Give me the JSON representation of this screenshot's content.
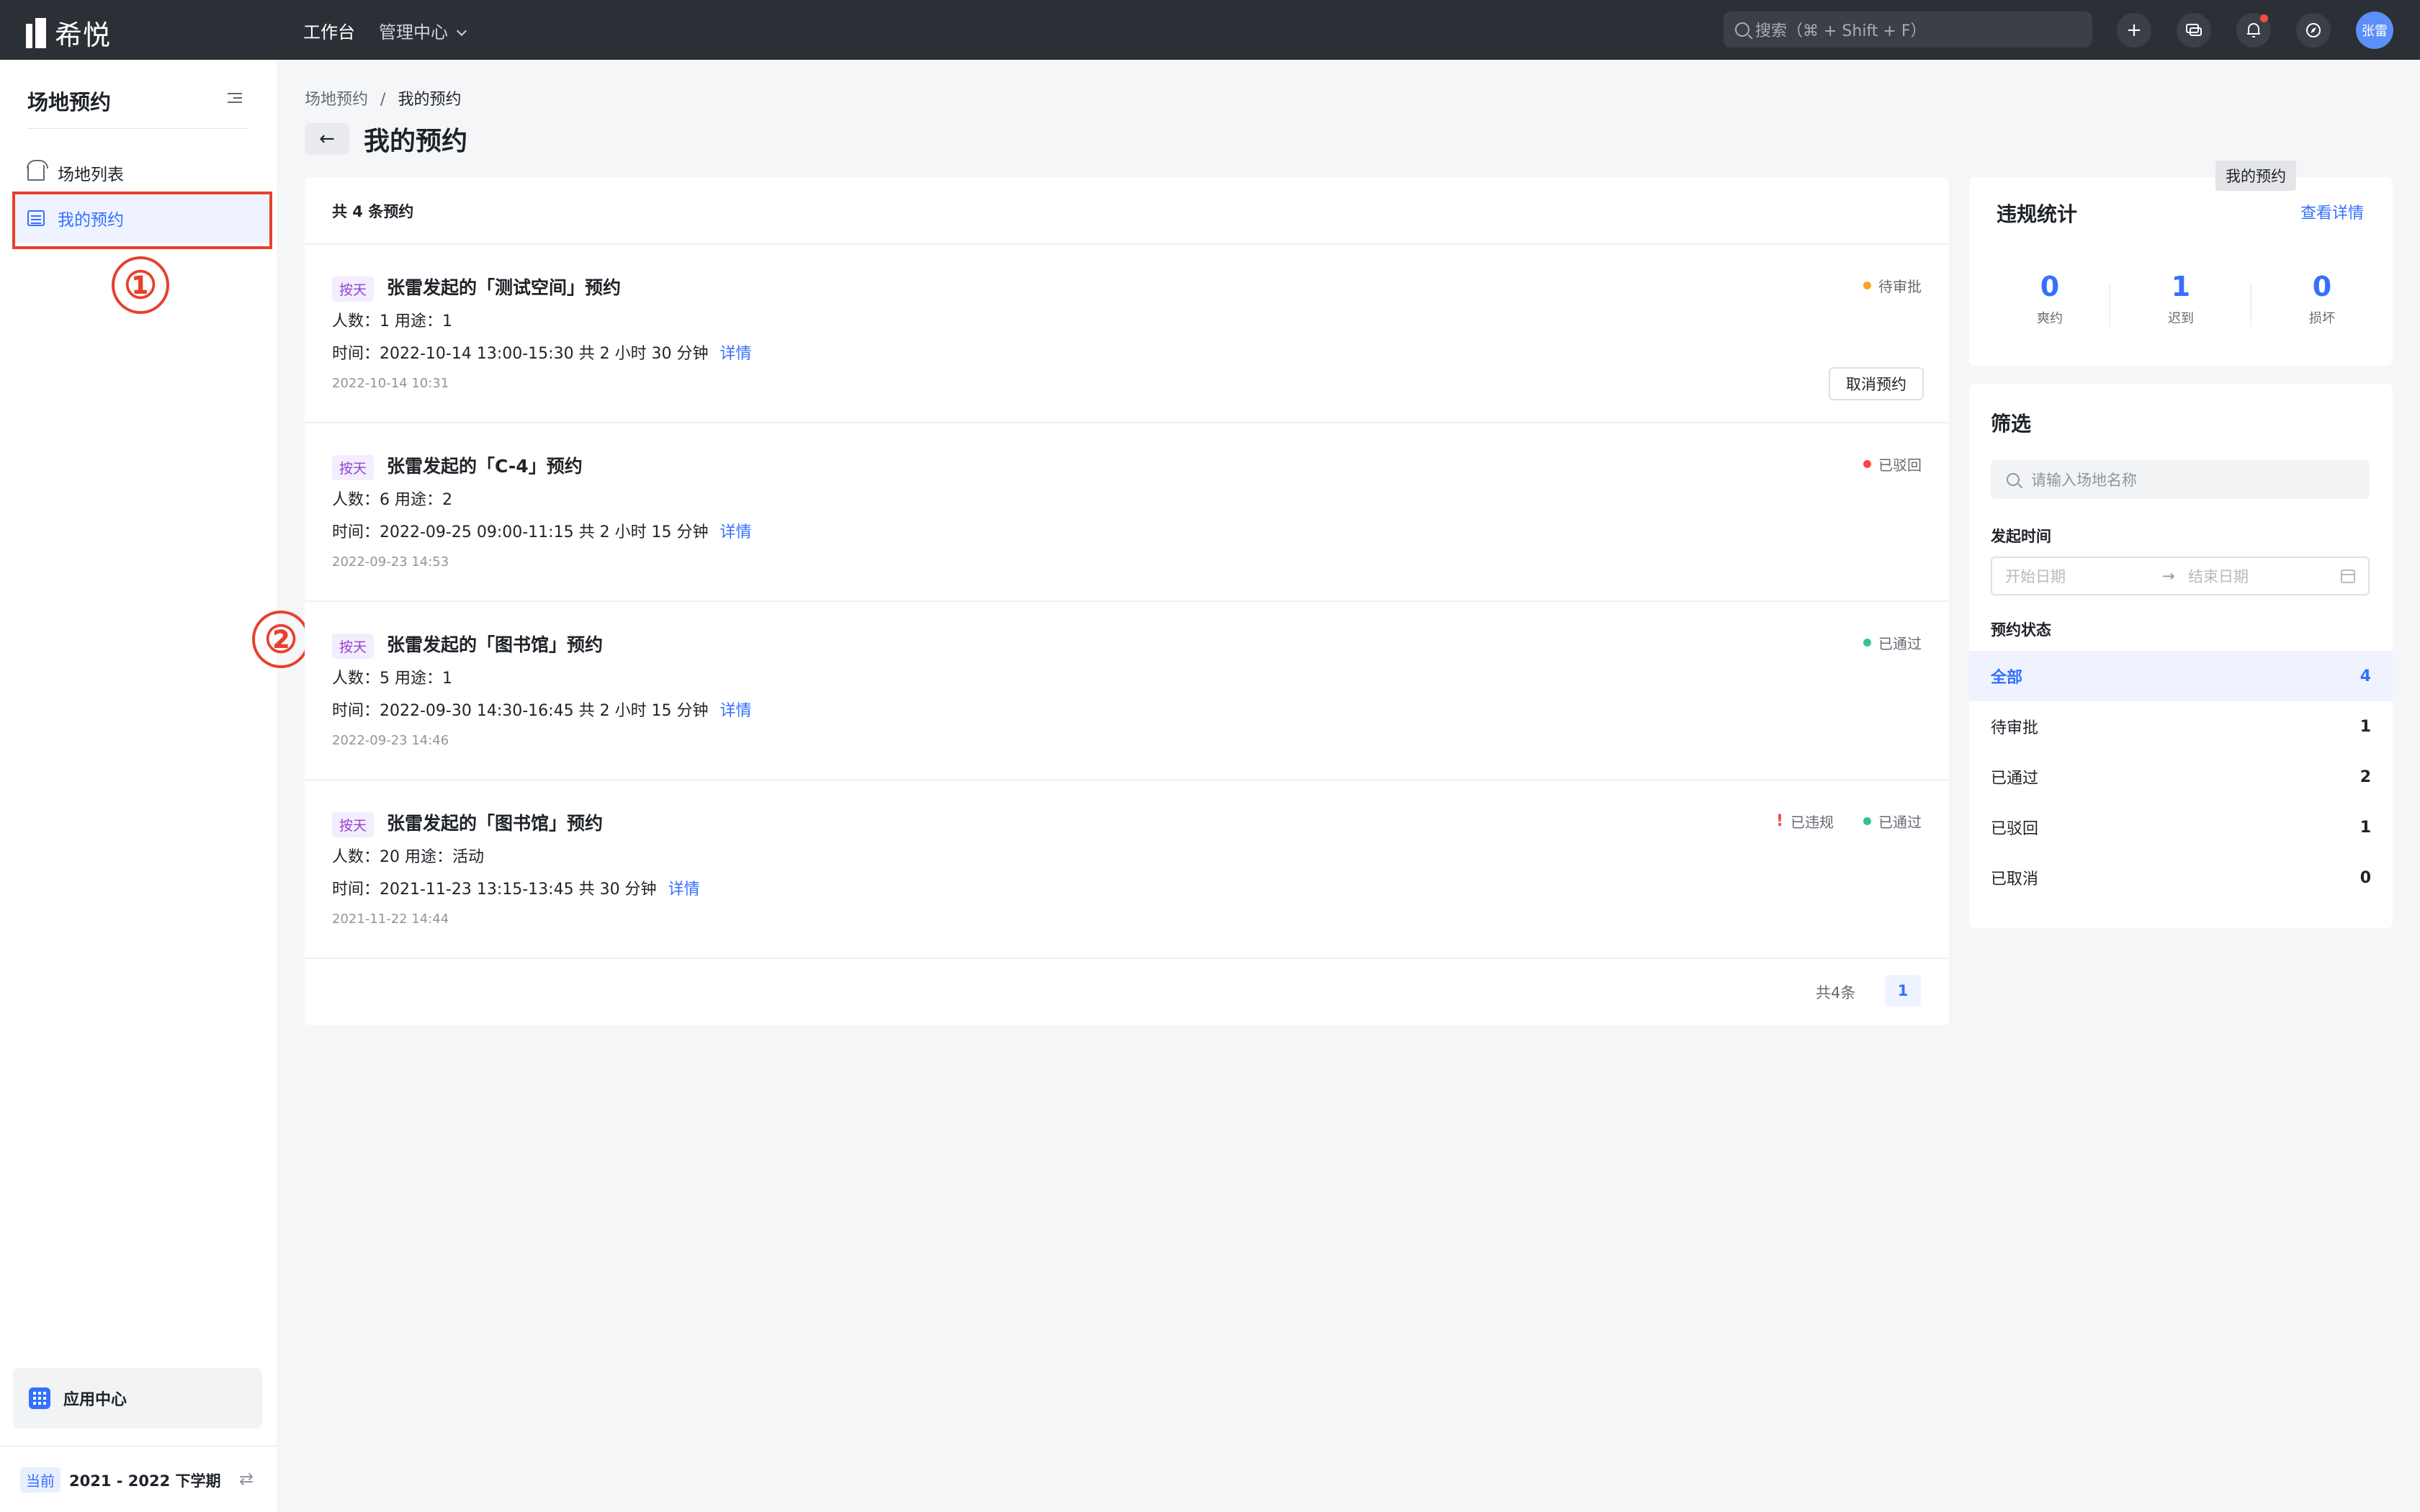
{
  "app": {
    "logo_text": "希悦"
  },
  "topnav": {
    "workbench": "工作台",
    "admin_center": "管理中心",
    "search_placeholder": "搜索（⌘ + Shift + F）",
    "avatar_text": "张雷"
  },
  "sidebar": {
    "title": "场地预约",
    "items": [
      {
        "label": "场地列表",
        "icon": "building-icon"
      },
      {
        "label": "我的预约",
        "icon": "calendar-icon"
      }
    ],
    "app_center": "应用中心",
    "term_tag": "当前",
    "term_name": "2021 - 2022 下学期"
  },
  "annotations": {
    "one": "①",
    "two": "②"
  },
  "breadcrumb": {
    "root": "场地预约",
    "sep": "/",
    "current": "我的预约"
  },
  "page": {
    "title": "我的预约"
  },
  "list": {
    "header": "共 4 条预约",
    "records": [
      {
        "tag": "按天",
        "title": "张雷发起的「测试空间」预约",
        "meta": "人数：1    用途：1",
        "time": "时间：2022-10-14    13:00-15:30    共 2 小时 30 分钟",
        "detail": "详情",
        "created": "2022-10-14 10:31",
        "status": "待审批",
        "status_color": "#f5a623",
        "action": "取消预约"
      },
      {
        "tag": "按天",
        "title": "张雷发起的「C-4」预约",
        "meta": "人数：6    用途：2",
        "time": "时间：2022-09-25    09:00-11:15    共 2 小时 15 分钟",
        "detail": "详情",
        "created": "2022-09-23 14:53",
        "status": "已驳回",
        "status_color": "#f54a45"
      },
      {
        "tag": "按天",
        "title": "张雷发起的「图书馆」预约",
        "meta": "人数：5    用途：1",
        "time": "时间：2022-09-30    14:30-16:45    共 2 小时 15 分钟",
        "detail": "详情",
        "created": "2022-09-23 14:46",
        "status": "已通过",
        "status_color": "#34c38f"
      },
      {
        "tag": "按天",
        "title": "张雷发起的「图书馆」预约",
        "meta": "人数：20    用途：活动",
        "time": "时间：2021-11-23    13:15-13:45    共 30 分钟",
        "detail": "详情",
        "created": "2021-11-22 14:44",
        "status": "已通过",
        "status_color": "#34c38f",
        "violation": "已违规"
      }
    ],
    "pager_total": "共4条",
    "pager_page": "1"
  },
  "stats": {
    "title": "违规统计",
    "link": "查看详情",
    "tooltip": "我的预约",
    "items": [
      {
        "value": "0",
        "label": "爽约"
      },
      {
        "value": "1",
        "label": "迟到"
      },
      {
        "value": "0",
        "label": "损坏"
      }
    ]
  },
  "filter": {
    "title": "筛选",
    "search_placeholder": "请输入场地名称",
    "time_label": "发起时间",
    "start_placeholder": "开始日期",
    "range_arrow": "→",
    "end_placeholder": "结束日期",
    "status_label": "预约状态",
    "statuses": [
      {
        "label": "全部",
        "count": "4"
      },
      {
        "label": "待审批",
        "count": "1"
      },
      {
        "label": "已通过",
        "count": "2"
      },
      {
        "label": "已驳回",
        "count": "1"
      },
      {
        "label": "已取消",
        "count": "0"
      }
    ]
  },
  "colors": {
    "accent": "#3370ff",
    "topbar": "#2b2f36",
    "annotation": "#e8402c"
  }
}
